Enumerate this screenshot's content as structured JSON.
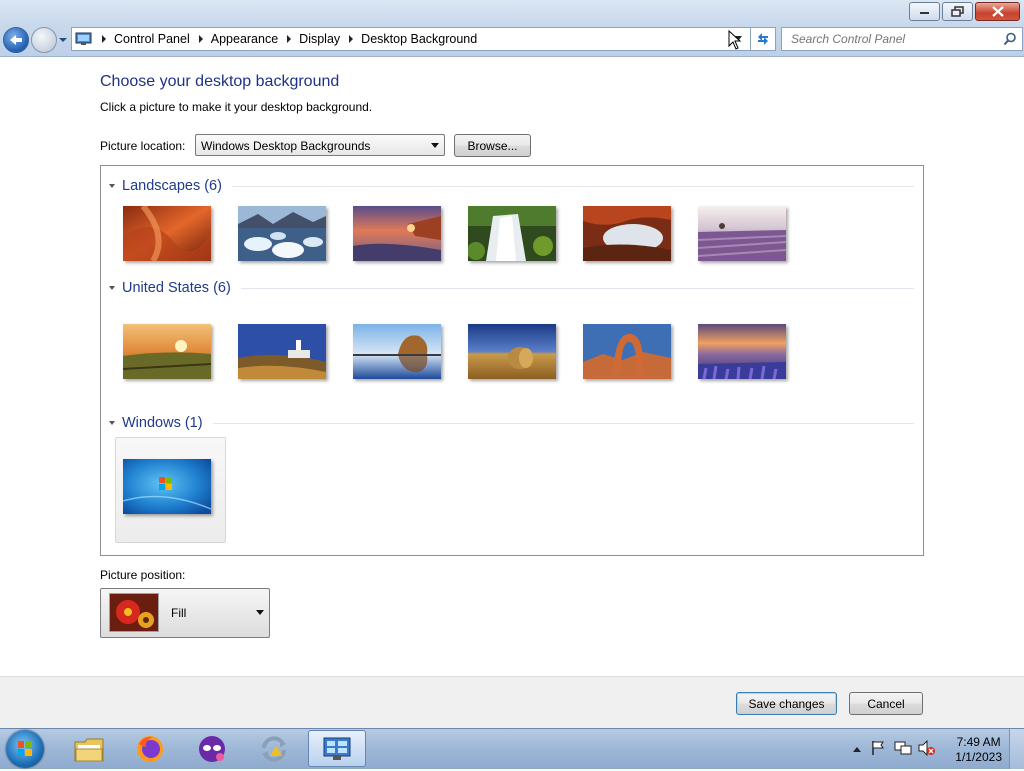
{
  "window": {
    "buttons": [
      "minimize",
      "maximize",
      "close"
    ]
  },
  "address": {
    "breadcrumbs": [
      "Control Panel",
      "Appearance",
      "Display",
      "Desktop Background"
    ],
    "search_placeholder": "Search Control Panel"
  },
  "page": {
    "title": "Choose your desktop background",
    "subtitle": "Click a picture to make it your desktop background.",
    "picture_location_label": "Picture location:",
    "picture_location_value": "Windows Desktop Backgrounds",
    "browse_label": "Browse...",
    "picture_position_label": "Picture position:",
    "picture_position_value": "Fill",
    "save_label": "Save changes",
    "cancel_label": "Cancel"
  },
  "groups": [
    {
      "title": "Landscapes (6)",
      "thumbnails": [
        "landscape-canyon",
        "landscape-ice",
        "landscape-coast",
        "landscape-waterfall",
        "landscape-arch-cave",
        "landscape-lavender"
      ]
    },
    {
      "title": "United States (6)",
      "thumbnails": [
        "us-sunset-field",
        "us-lighthouse",
        "us-rock-lake",
        "us-hay-bale",
        "us-delicate-arch",
        "us-lupine-lake"
      ]
    },
    {
      "title": "Windows (1)",
      "thumbnails": [
        "windows-default"
      ],
      "selected": "windows-default"
    }
  ],
  "taskbar": {
    "items": [
      "file-explorer",
      "firefox",
      "privacy-app",
      "sync-app",
      "control-panel"
    ],
    "active": "control-panel",
    "time": "7:49 AM",
    "date": "1/1/2023"
  },
  "colors": {
    "title_blue": "#1e3287",
    "group_blue": "#1e3a8a",
    "taskbar": "#9db7d6"
  }
}
